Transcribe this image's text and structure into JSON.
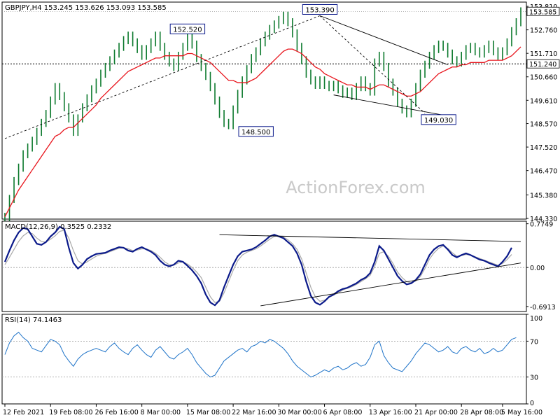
{
  "chart_data": [
    {
      "type": "line",
      "panel": "price",
      "title": "GBPJPY,H4  153.245 153.626 153.093 153.585",
      "watermark": "ActionForex.com",
      "ylim": [
        144.3,
        154.0
      ],
      "y_ticks": [
        "153.810",
        "152.760",
        "151.710",
        "150.660",
        "149.610",
        "148.570",
        "147.520",
        "146.470",
        "145.380",
        "144.330"
      ],
      "y_tick_values": [
        153.81,
        152.76,
        151.71,
        150.66,
        149.61,
        148.57,
        147.52,
        146.47,
        145.38,
        144.33
      ],
      "last_price": "153.585",
      "level_line": {
        "value": 151.24,
        "label": "151.240"
      },
      "annotations": [
        {
          "text": "152.520",
          "x": 40,
          "y": 152.52
        },
        {
          "text": "148.500",
          "x": 55,
          "y": 148.5
        },
        {
          "text": "153.390",
          "x": 69,
          "y": 153.39
        },
        {
          "text": "149.030",
          "x": 95,
          "y": 149.03
        }
      ],
      "series": [
        {
          "role": "price",
          "values": [
            144.4,
            145.2,
            146.0,
            146.6,
            147.2,
            147.5,
            147.8,
            148.2,
            148.6,
            149.0,
            149.6,
            150.2,
            149.8,
            149.3,
            148.8,
            148.2,
            148.8,
            149.3,
            149.7,
            150.1,
            150.4,
            150.8,
            151.1,
            151.4,
            151.7,
            152.0,
            152.3,
            152.5,
            152.2,
            151.9,
            151.6,
            151.9,
            152.2,
            152.5,
            152.0,
            151.6,
            151.3,
            151.1,
            151.6,
            152.0,
            152.52,
            152.1,
            151.5,
            151.1,
            150.7,
            150.2,
            149.6,
            149.0,
            148.6,
            148.5,
            149.2,
            149.9,
            150.5,
            151.0,
            151.5,
            151.8,
            152.2,
            152.5,
            152.8,
            153.0,
            153.2,
            153.39,
            153.1,
            152.6,
            152.0,
            151.4,
            150.8,
            150.5,
            150.3,
            150.5,
            150.3,
            150.2,
            150.3,
            150.1,
            149.9,
            150.0,
            149.8,
            150.2,
            150.5,
            150.2,
            150.0,
            151.3,
            151.6,
            151.1,
            150.4,
            150.0,
            149.5,
            149.2,
            149.03,
            149.5,
            150.2,
            150.8,
            151.2,
            151.6,
            151.9,
            152.1,
            152.0,
            151.7,
            151.4,
            151.3,
            151.6,
            151.9,
            152.0,
            151.8,
            151.7,
            151.9,
            152.1,
            151.8,
            151.6,
            151.8,
            152.2,
            152.7,
            153.1,
            153.585
          ]
        },
        {
          "role": "moving-average",
          "color": "#e8141c",
          "values": [
            144.4,
            144.8,
            145.2,
            145.6,
            145.9,
            146.2,
            146.5,
            146.8,
            147.1,
            147.4,
            147.7,
            148.0,
            148.1,
            148.3,
            148.4,
            148.4,
            148.6,
            148.8,
            149.0,
            149.2,
            149.4,
            149.7,
            149.9,
            150.1,
            150.3,
            150.5,
            150.7,
            150.9,
            151.0,
            151.1,
            151.2,
            151.3,
            151.4,
            151.5,
            151.5,
            151.6,
            151.6,
            151.6,
            151.6,
            151.6,
            151.7,
            151.7,
            151.6,
            151.5,
            151.4,
            151.3,
            151.1,
            150.9,
            150.7,
            150.5,
            150.5,
            150.4,
            150.4,
            150.4,
            150.5,
            150.6,
            150.8,
            151.0,
            151.2,
            151.4,
            151.6,
            151.8,
            151.9,
            151.9,
            151.8,
            151.7,
            151.5,
            151.3,
            151.1,
            151.0,
            150.8,
            150.7,
            150.6,
            150.5,
            150.4,
            150.3,
            150.3,
            150.2,
            150.2,
            150.2,
            150.1,
            150.2,
            150.3,
            150.3,
            150.2,
            150.1,
            150.0,
            149.9,
            149.8,
            149.8,
            149.9,
            150.0,
            150.2,
            150.4,
            150.6,
            150.8,
            150.9,
            151.0,
            151.1,
            151.1,
            151.2,
            151.2,
            151.3,
            151.3,
            151.3,
            151.3,
            151.4,
            151.4,
            151.4,
            151.4,
            151.5,
            151.6,
            151.8,
            152.0
          ]
        }
      ],
      "trendlines": [
        {
          "x1": 0,
          "y1": 147.9,
          "x2": 69,
          "y2": 153.39,
          "dashed": true
        },
        {
          "x1": 69,
          "y1": 153.39,
          "x2": 92,
          "y2": 149.03,
          "dashed": true
        },
        {
          "x1": 69,
          "y1": 153.39,
          "x2": 97,
          "y2": 151.2,
          "dashed": false
        },
        {
          "x1": 72,
          "y1": 149.85,
          "x2": 96,
          "y2": 148.95,
          "dashed": false
        }
      ]
    },
    {
      "type": "line",
      "panel": "macd",
      "title": "MACD(12,26,9) 0.3525 0.2332",
      "ylim": [
        -0.78,
        0.82
      ],
      "y_ticks": [
        "0.7749",
        "0.00",
        "-0.6913"
      ],
      "y_tick_values": [
        0.7749,
        0.0,
        -0.6913
      ],
      "zero_line": 0.0,
      "series": [
        {
          "role": "macd",
          "color": "#0b1a8a",
          "values": [
            0.1,
            0.3,
            0.48,
            0.62,
            0.7,
            0.68,
            0.55,
            0.42,
            0.4,
            0.45,
            0.55,
            0.62,
            0.72,
            0.68,
            0.35,
            0.08,
            -0.02,
            0.05,
            0.15,
            0.2,
            0.24,
            0.25,
            0.26,
            0.3,
            0.33,
            0.36,
            0.35,
            0.3,
            0.28,
            0.33,
            0.36,
            0.32,
            0.28,
            0.22,
            0.12,
            0.05,
            0.02,
            0.05,
            0.12,
            0.1,
            0.03,
            -0.05,
            -0.15,
            -0.28,
            -0.48,
            -0.62,
            -0.67,
            -0.58,
            -0.35,
            -0.15,
            0.05,
            0.2,
            0.28,
            0.3,
            0.32,
            0.36,
            0.42,
            0.48,
            0.55,
            0.58,
            0.55,
            0.52,
            0.45,
            0.38,
            0.25,
            0.05,
            -0.25,
            -0.5,
            -0.62,
            -0.66,
            -0.6,
            -0.52,
            -0.48,
            -0.42,
            -0.38,
            -0.36,
            -0.32,
            -0.28,
            -0.22,
            -0.18,
            -0.1,
            0.1,
            0.38,
            0.3,
            0.15,
            0.0,
            -0.15,
            -0.24,
            -0.3,
            -0.28,
            -0.22,
            -0.12,
            0.05,
            0.22,
            0.32,
            0.38,
            0.4,
            0.32,
            0.22,
            0.18,
            0.22,
            0.25,
            0.22,
            0.18,
            0.14,
            0.12,
            0.08,
            0.05,
            0.02,
            0.1,
            0.2,
            0.35
          ]
        },
        {
          "role": "signal",
          "color": "#a9a9a9",
          "values": [
            0.05,
            0.18,
            0.32,
            0.46,
            0.56,
            0.62,
            0.6,
            0.52,
            0.46,
            0.45,
            0.5,
            0.56,
            0.64,
            0.66,
            0.52,
            0.3,
            0.12,
            0.06,
            0.1,
            0.15,
            0.2,
            0.23,
            0.25,
            0.28,
            0.31,
            0.34,
            0.35,
            0.33,
            0.3,
            0.31,
            0.33,
            0.33,
            0.3,
            0.25,
            0.18,
            0.1,
            0.05,
            0.04,
            0.08,
            0.1,
            0.06,
            0.0,
            -0.08,
            -0.18,
            -0.35,
            -0.52,
            -0.62,
            -0.6,
            -0.45,
            -0.25,
            -0.05,
            0.12,
            0.22,
            0.27,
            0.3,
            0.33,
            0.38,
            0.44,
            0.5,
            0.55,
            0.56,
            0.54,
            0.49,
            0.42,
            0.32,
            0.15,
            -0.1,
            -0.35,
            -0.52,
            -0.6,
            -0.58,
            -0.53,
            -0.49,
            -0.45,
            -0.4,
            -0.37,
            -0.34,
            -0.3,
            -0.25,
            -0.2,
            -0.14,
            0.02,
            0.25,
            0.28,
            0.2,
            0.07,
            -0.08,
            -0.18,
            -0.25,
            -0.27,
            -0.24,
            -0.16,
            -0.02,
            0.15,
            0.26,
            0.34,
            0.38,
            0.34,
            0.26,
            0.2,
            0.21,
            0.23,
            0.22,
            0.19,
            0.16,
            0.13,
            0.1,
            0.07,
            0.04,
            0.07,
            0.14,
            0.23
          ]
        }
      ],
      "trendlines": [
        {
          "x1": 47,
          "y1": 0.58,
          "x2": 113,
          "y2": 0.46,
          "dashed": false
        },
        {
          "x1": 56,
          "y1": -0.68,
          "x2": 113,
          "y2": 0.08,
          "dashed": false
        }
      ]
    },
    {
      "type": "line",
      "panel": "rsi",
      "title": "RSI(14) 74.1463",
      "ylim": [
        0,
        100
      ],
      "y_ticks": [
        "100",
        "70",
        "30",
        "0"
      ],
      "y_tick_values": [
        100,
        70,
        30,
        0
      ],
      "levels": [
        70,
        30
      ],
      "series": [
        {
          "role": "rsi",
          "color": "#1e73c8",
          "values": [
            55,
            68,
            76,
            80,
            74,
            70,
            62,
            60,
            58,
            65,
            72,
            70,
            66,
            55,
            48,
            42,
            50,
            55,
            58,
            60,
            62,
            60,
            58,
            64,
            68,
            62,
            58,
            55,
            62,
            66,
            60,
            55,
            52,
            60,
            64,
            58,
            52,
            50,
            55,
            58,
            62,
            55,
            46,
            40,
            34,
            30,
            32,
            40,
            48,
            52,
            56,
            60,
            62,
            58,
            64,
            66,
            70,
            68,
            72,
            70,
            66,
            62,
            56,
            48,
            42,
            38,
            34,
            30,
            32,
            35,
            38,
            36,
            40,
            42,
            38,
            40,
            44,
            46,
            42,
            44,
            52,
            66,
            70,
            54,
            46,
            40,
            38,
            36,
            42,
            48,
            56,
            62,
            68,
            66,
            62,
            58,
            60,
            64,
            58,
            56,
            62,
            64,
            60,
            58,
            62,
            56,
            58,
            62,
            58,
            60,
            66,
            72,
            74
          ]
        }
      ]
    }
  ],
  "x_axis": {
    "labels": [
      "12 Feb 2021",
      "19 Feb 08:00",
      "26 Feb 16:00",
      "8 Mar 00:00",
      "15 Mar 08:00",
      "22 Mar 16:00",
      "30 Mar 00:00",
      "6 Apr 08:00",
      "13 Apr 16:00",
      "21 Apr 00:00",
      "28 Apr 08:00",
      "5 May 16:00"
    ],
    "label_bars": [
      0,
      10,
      20,
      30,
      40,
      50,
      60,
      70,
      80,
      90,
      100,
      109
    ]
  }
}
